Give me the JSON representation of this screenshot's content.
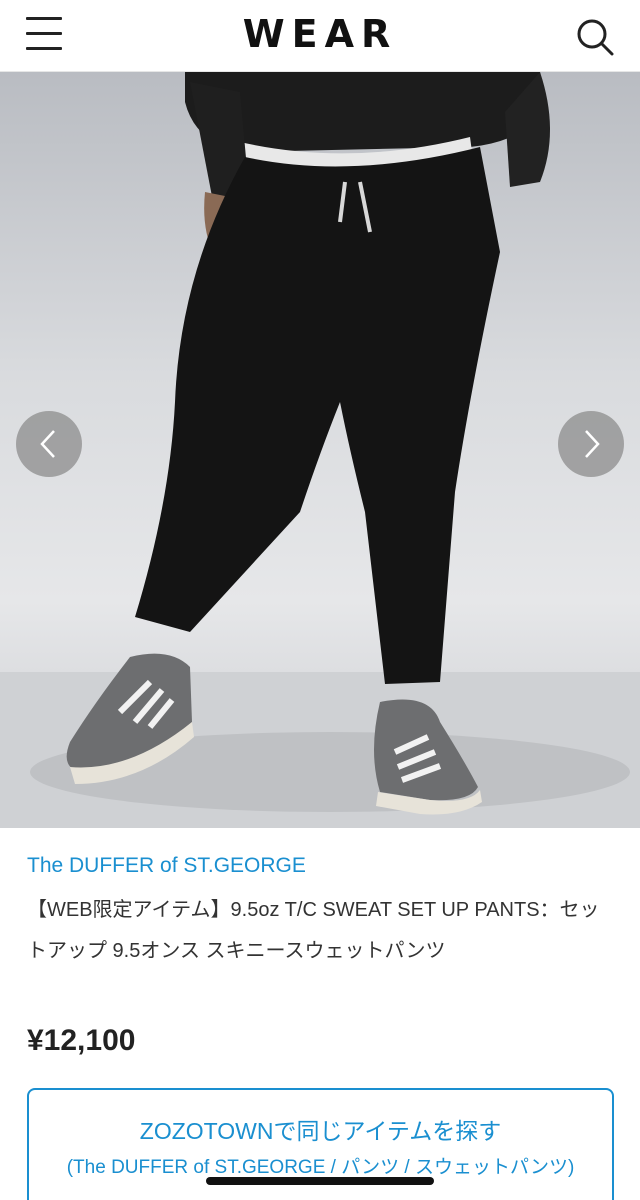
{
  "header": {
    "logo": "WEAR",
    "menu_icon": "hamburger-menu-icon",
    "search_icon": "search-icon"
  },
  "gallery": {
    "prev_icon": "chevron-left-icon",
    "next_icon": "chevron-right-icon"
  },
  "product": {
    "brand": "The DUFFER of ST.GEORGE",
    "title": "【WEB限定アイテム】9.5oz T/C SWEAT SET UP PANTS：セットアップ 9.5オンス スキニースウェットパンツ",
    "price": "¥12,100"
  },
  "zozo_button": {
    "label": "ZOZOTOWNで同じアイテムを探す",
    "sublabel": "(The DUFFER of ST.GEORGE / パンツ / スウェットパンツ)"
  },
  "colors": {
    "accent": "#1a8fd0",
    "text": "#333333"
  }
}
